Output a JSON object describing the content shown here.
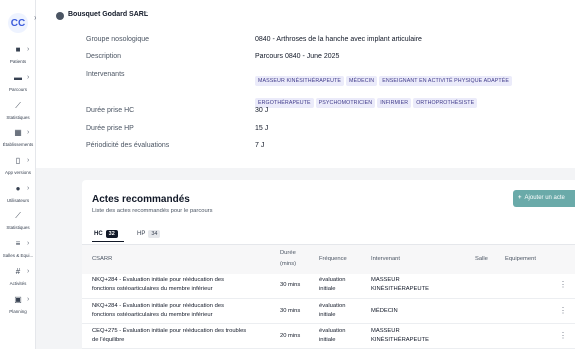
{
  "sidebar": {
    "logo": "CC",
    "items": [
      {
        "label": "Patients",
        "icon": "patient-icon"
      },
      {
        "label": "Parcours",
        "icon": "folder-icon"
      },
      {
        "label": "Statistiques",
        "icon": "chart-icon"
      },
      {
        "label": "Établissements",
        "icon": "building-icon"
      },
      {
        "label": "App versions",
        "icon": "phone-icon"
      },
      {
        "label": "Utilisateurs",
        "icon": "user-icon"
      },
      {
        "label": "Statistiques",
        "icon": "chart-icon"
      },
      {
        "label": "Salles & Equi...",
        "icon": "room-icon"
      },
      {
        "label": "Activités",
        "icon": "activity-icon"
      },
      {
        "label": "Planning",
        "icon": "calendar-icon"
      }
    ]
  },
  "header": {
    "company": "Bousquet Godard SARL"
  },
  "info": {
    "groupe_label": "Groupe nosologique",
    "groupe_value": "0840 - Arthroses de la hanche avec implant articulaire",
    "description_label": "Description",
    "description_value": "Parcours 0840 - June 2025",
    "intervenants_label": "Intervenants",
    "intervenants": [
      "MASSEUR KINÉSITHÉRAPEUTE",
      "MÉDECIN",
      "ENSEIGNANT EN ACTIVITÉ PHYSIQUE ADAPTÉE",
      "ERGOTHÉRAPEUTE",
      "PSYCHOMOTRICIEN",
      "INFIRMIER",
      "ORTHOPROTHÉSISTE"
    ],
    "duree_hc_label": "Durée prise HC",
    "duree_hc_value": "30 J",
    "duree_hp_label": "Durée prise HP",
    "duree_hp_value": "15 J",
    "periodicite_label": "Périodicité des évaluations",
    "periodicite_value": "7 J"
  },
  "actes": {
    "title": "Actes recommandés",
    "subtitle": "Liste des actes recommandés pour le parcours",
    "add_button": "Ajouter un acte",
    "tabs": [
      {
        "label": "HC",
        "count": "32"
      },
      {
        "label": "HP",
        "count": "34"
      }
    ],
    "columns": {
      "csarr": "CSARR",
      "duree_1": "Durée",
      "duree_2": "(mins)",
      "frequence": "Fréquence",
      "intervenant": "Intervenant",
      "salle": "Salle",
      "equipement": "Equipement"
    },
    "rows": [
      {
        "csarr_1": "NKQ+284 - Évaluation initiale pour rééducation des",
        "csarr_2": "fonctions ostéoarticulaires du membre inférieur",
        "duree": "30 mins",
        "freq_1": "évaluation",
        "freq_2": "initiale",
        "interv_1": "MASSEUR",
        "interv_2": "KINÉSITHÉRAPEUTE"
      },
      {
        "csarr_1": "NKQ+284 - Évaluation initiale pour rééducation des",
        "csarr_2": "fonctions ostéoarticulaires du membre inférieur",
        "duree": "30 mins",
        "freq_1": "évaluation",
        "freq_2": "initiale",
        "interv_1": "MÉDECIN",
        "interv_2": ""
      },
      {
        "csarr_1": "CEQ+275 - Évaluation initiale pour rééducation des troubles",
        "csarr_2": "de l'équilibre",
        "duree": "20 mins",
        "freq_1": "évaluation",
        "freq_2": "initiale",
        "interv_1": "MASSEUR",
        "interv_2": "KINÉSITHÉRAPEUTE"
      }
    ]
  }
}
